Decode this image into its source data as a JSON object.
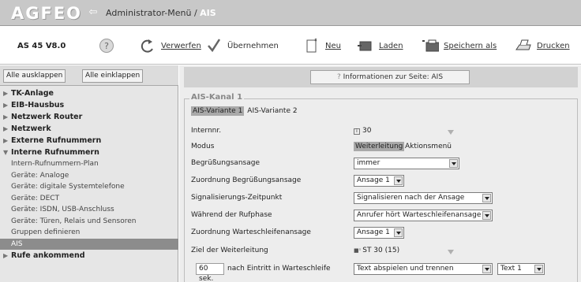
{
  "header": {
    "logo": "AGFEO",
    "breadcrumb_prefix": "Administrator-Menü /",
    "breadcrumb_current": "AIS"
  },
  "toolbar": {
    "version": "AS 45 V8.0",
    "discard": "Verwerfen",
    "apply": "Übernehmen",
    "new": "Neu",
    "load": "Laden",
    "save_as": "Speichern als",
    "print": "Drucken"
  },
  "sidebar": {
    "expand_all": "Alle ausklappen",
    "collapse_all": "Alle einklappen",
    "items": [
      {
        "label": "TK-Anlage"
      },
      {
        "label": "EIB-Hausbus"
      },
      {
        "label": "Netzwerk Router"
      },
      {
        "label": "Netzwerk"
      },
      {
        "label": "Externe Rufnummern"
      },
      {
        "label": "Interne Rufnummern"
      }
    ],
    "subitems": [
      {
        "label": "Intern-Rufnummern-Plan"
      },
      {
        "label": "Geräte: Analoge"
      },
      {
        "label": "Geräte: digitale Systemtelefone"
      },
      {
        "label": "Geräte: DECT"
      },
      {
        "label": "Geräte: ISDN, USB-Anschluss"
      },
      {
        "label": "Geräte: Türen, Relais und Sensoren"
      },
      {
        "label": "Gruppen definieren"
      },
      {
        "label": "AIS"
      }
    ],
    "last_item": "Rufe ankommend"
  },
  "main": {
    "info_button": "Informationen zur Seite: AIS",
    "group_title": "AIS-Kanal 1",
    "variant1": "AIS-Variante 1",
    "variant2": "AIS-Variante 2",
    "fields": {
      "internnr_label": "Internnr.",
      "internnr_value": "30",
      "modus_label": "Modus",
      "modus_opt1": "Weiterleitung",
      "modus_opt2": "Aktionsmenü",
      "greeting_label": "Begrüßungsansage",
      "greeting_value": "immer",
      "greeting_assign_label": "Zuordnung Begrüßungsansage",
      "greeting_assign_value": "Ansage 1",
      "signal_label": "Signalisierungs-Zeitpunkt",
      "signal_value": "Signalisieren nach der Ansage",
      "ringing_label": "Während der Rufphase",
      "ringing_value": "Anrufer hört Warteschleifenansage",
      "hold_assign_label": "Zuordnung Warteschleifenansage",
      "hold_assign_value": "Ansage 1",
      "target_label": "Ziel der Weiterleitung",
      "target_value": "ST 30 (15)",
      "delay_value": "60 sek.",
      "delay_label": "nach Eintritt in Warteschleife",
      "action_value": "Text abspielen und trennen",
      "text_value": "Text 1"
    }
  },
  "colors": {
    "header_bg": "#c8c8c8",
    "sidebar_bg": "#e6e6e6",
    "main_bg": "#ededed",
    "selected_bg": "#8c8c8c"
  }
}
